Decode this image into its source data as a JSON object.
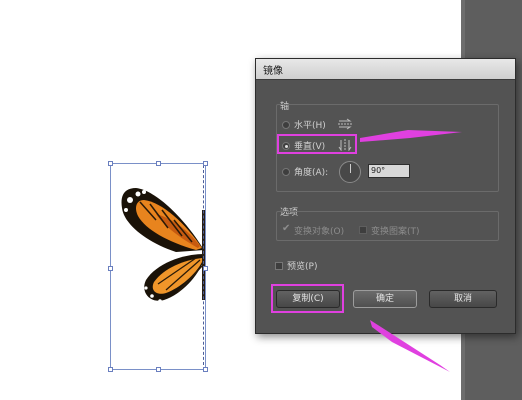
{
  "dialog": {
    "title": "镜像",
    "axis_group": "轴",
    "horizontal_label": "水平(H)",
    "vertical_label": "垂直(V)",
    "angle_label": "角度(A):",
    "angle_value": "90°",
    "options_group": "选项",
    "transform_objects": "变换对象(O)",
    "transform_patterns": "变换图案(T)",
    "preview": "预览(P)",
    "copy_button": "复制(C)",
    "ok_button": "确定",
    "cancel_button": "取消"
  },
  "state": {
    "selected_axis": "vertical",
    "transform_objects_checked": true,
    "transform_patterns_checked": false,
    "preview_checked": false
  },
  "colors": {
    "highlight": "#e040e0",
    "dialog_bg": "#535353",
    "butterfly_orange": "#e8841e"
  },
  "icons": [
    "horizontal-axis-icon",
    "vertical-axis-icon",
    "angle-dial-icon",
    "checkmark-icon",
    "butterfly-image",
    "annotation-arrow"
  ]
}
